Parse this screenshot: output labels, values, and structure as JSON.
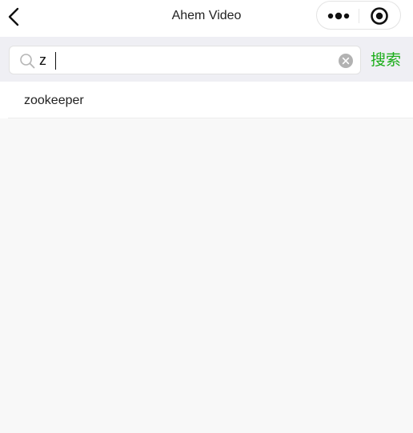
{
  "nav": {
    "title": "Ahem Video",
    "back_icon": "chevron-left-icon",
    "more_icon": "more-dots-icon",
    "close_icon": "target-circle-icon"
  },
  "search": {
    "value": "z",
    "placeholder": "",
    "search_icon": "search-icon",
    "clear_icon": "clear-circle-icon",
    "submit_label": "搜索"
  },
  "suggestions": [
    {
      "label": "zookeeper"
    }
  ],
  "colors": {
    "accent": "#1aad19",
    "background": "#f8f8f8",
    "search_bar_bg": "#efeff4"
  }
}
